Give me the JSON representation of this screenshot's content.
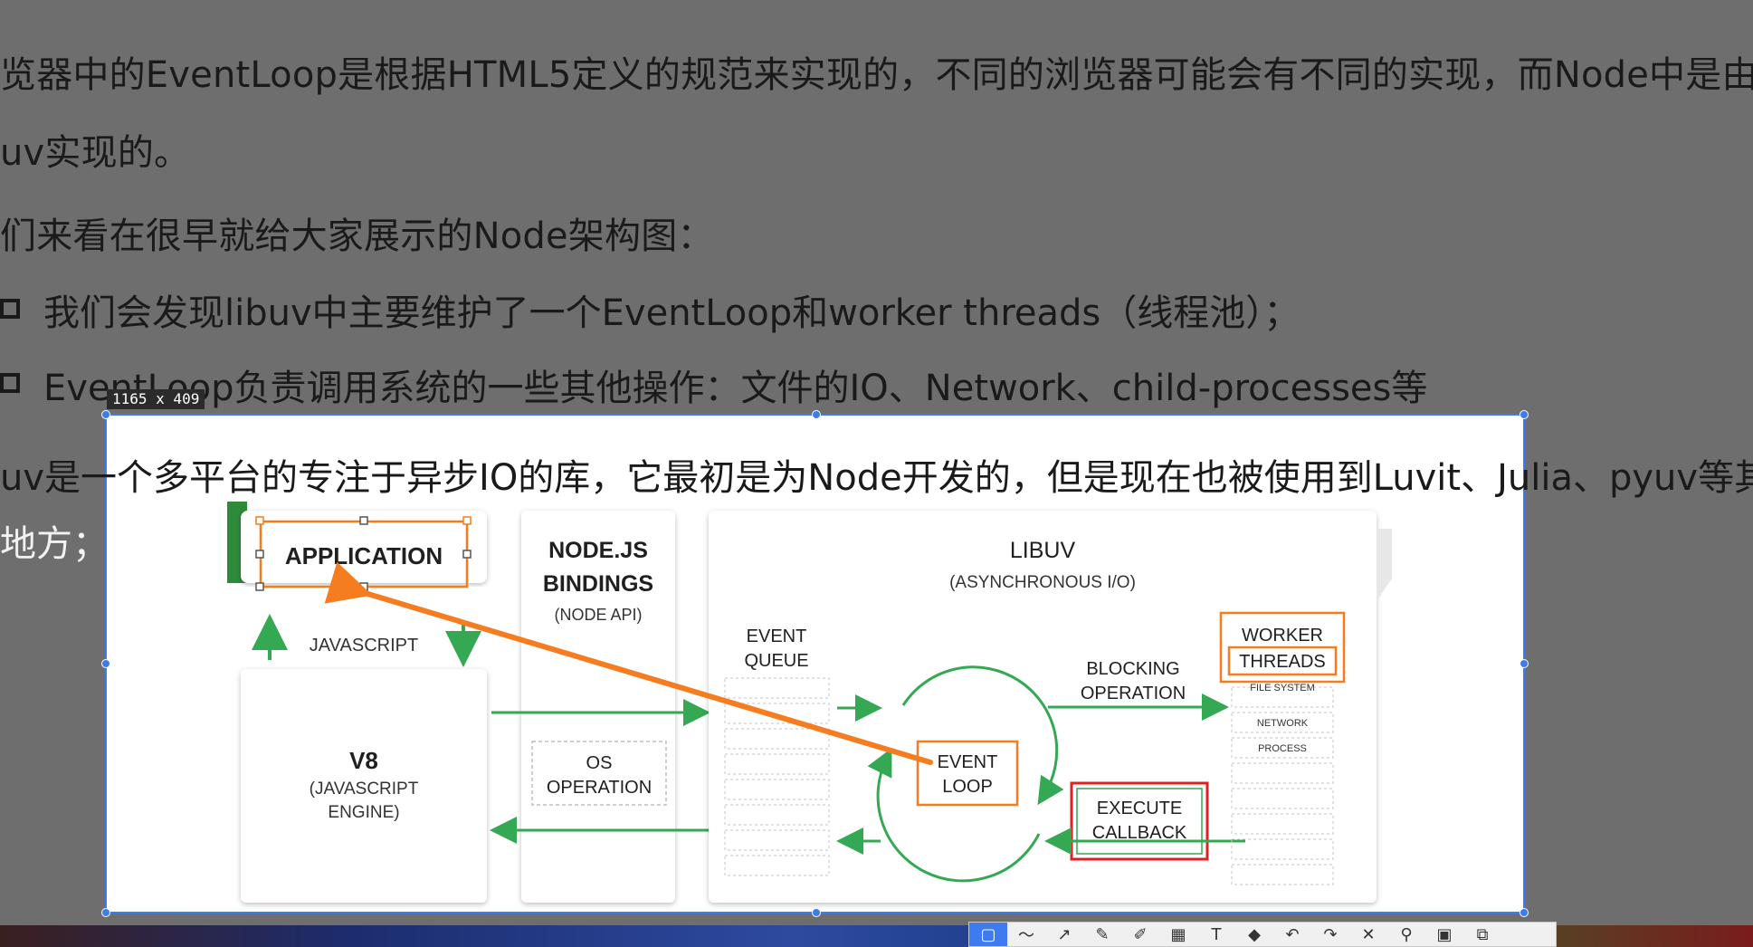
{
  "doc": {
    "line1": "览器中的EventLoop是根据HTML5定义的规范来实现的，不同的浏览器可能会有不同的实现，而Node中是由",
    "line2": "uv实现的。",
    "line3": "们来看在很早就给大家展示的Node架构图：",
    "bullet1": "我们会发现libuv中主要维护了一个EventLoop和worker threads（线程池）；",
    "bullet2": "EventLoop负责调用系统的一些其他操作：文件的IO、Network、child-processes等",
    "line4": "uv是一个多平台的专注于异步IO的库，它最初是为Node开发的，但是现在也被使用到Luvit、Julia、pyuv等其",
    "line5": "地方；"
  },
  "capture": {
    "size_label": "1165 x 409"
  },
  "diagram": {
    "application": "APPLICATION",
    "javascript": "JAVASCRIPT",
    "v8_title": "V8",
    "v8_sub1": "(JAVASCRIPT",
    "v8_sub2": "ENGINE)",
    "bindings_l1": "NODE.JS",
    "bindings_l2": "BINDINGS",
    "bindings_sub": "(NODE API)",
    "os_l1": "OS",
    "os_l2": "OPERATION",
    "libuv_title": "LIBUV",
    "libuv_sub": "(ASYNCHRONOUS I/O)",
    "event_queue_l1": "EVENT",
    "event_queue_l2": "QUEUE",
    "event_loop_l1": "EVENT",
    "event_loop_l2": "LOOP",
    "blocking_l1": "BLOCKING",
    "blocking_l2": "OPERATION",
    "worker_l1": "WORKER",
    "worker_l2": "THREADS",
    "wt_file": "FILE SYSTEM",
    "wt_network": "NETWORK",
    "wt_process": "PROCESS",
    "callback_l1": "EXECUTE",
    "callback_l2": "CALLBACK"
  },
  "toolbar": {
    "tools": [
      "select-tool",
      "pen-tool",
      "arrow-tool",
      "pencil-tool",
      "marker-tool",
      "mosaic-tool",
      "text-tool",
      "eraser-tool",
      "undo-tool",
      "redo-tool",
      "close-tool",
      "pin-tool",
      "save-tool",
      "copy-tool"
    ]
  },
  "colors": {
    "green": "#34a853",
    "orange": "#f57c1f",
    "red": "#e02020",
    "selection": "#3e7bf0"
  }
}
